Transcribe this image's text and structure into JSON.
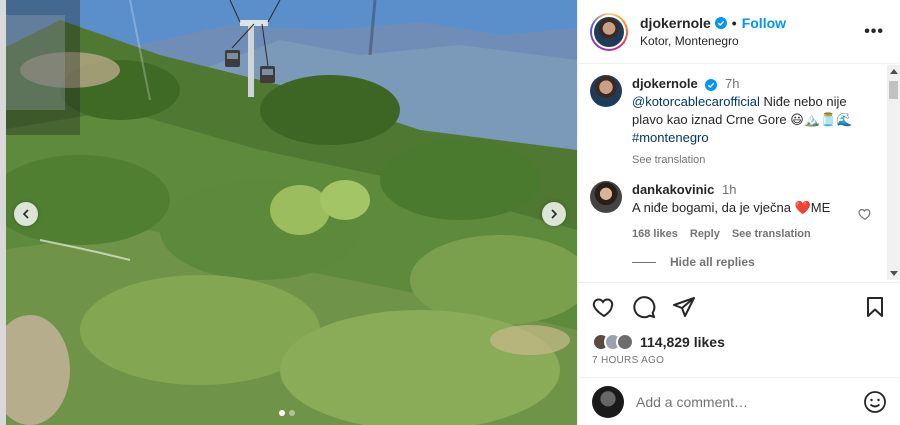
{
  "post": {
    "username": "djokernole",
    "location": "Kotor, Montenegro",
    "follow_label": "Follow",
    "separator": "•",
    "more_label": "•••"
  },
  "media": {
    "carousel_count": 2,
    "active_index": 1
  },
  "comments": [
    {
      "username": "djokernole",
      "time": "7h",
      "mention": "@kotorcablecarofficial",
      "text": "Niđe nebo nije plavo kao iznad Crne Gore 😃🏔️🫙🌊",
      "hashtag": "#montenegro",
      "see_translation": "See translation"
    },
    {
      "username": "dankakovinic",
      "time": "1h",
      "text": "A niđe bogami, da je vječna ❤️ME",
      "likes": "168 likes",
      "reply": "Reply",
      "see_translation": "See translation",
      "hide_replies": "Hide all replies"
    }
  ],
  "footer": {
    "likes": "114,829 likes",
    "date": "7 HOURS AGO",
    "add_comment_placeholder": "Add a comment…"
  },
  "colors": {
    "accent": "#0095f6",
    "link": "#00376b",
    "muted": "#737373",
    "heart": "#ed4956"
  }
}
